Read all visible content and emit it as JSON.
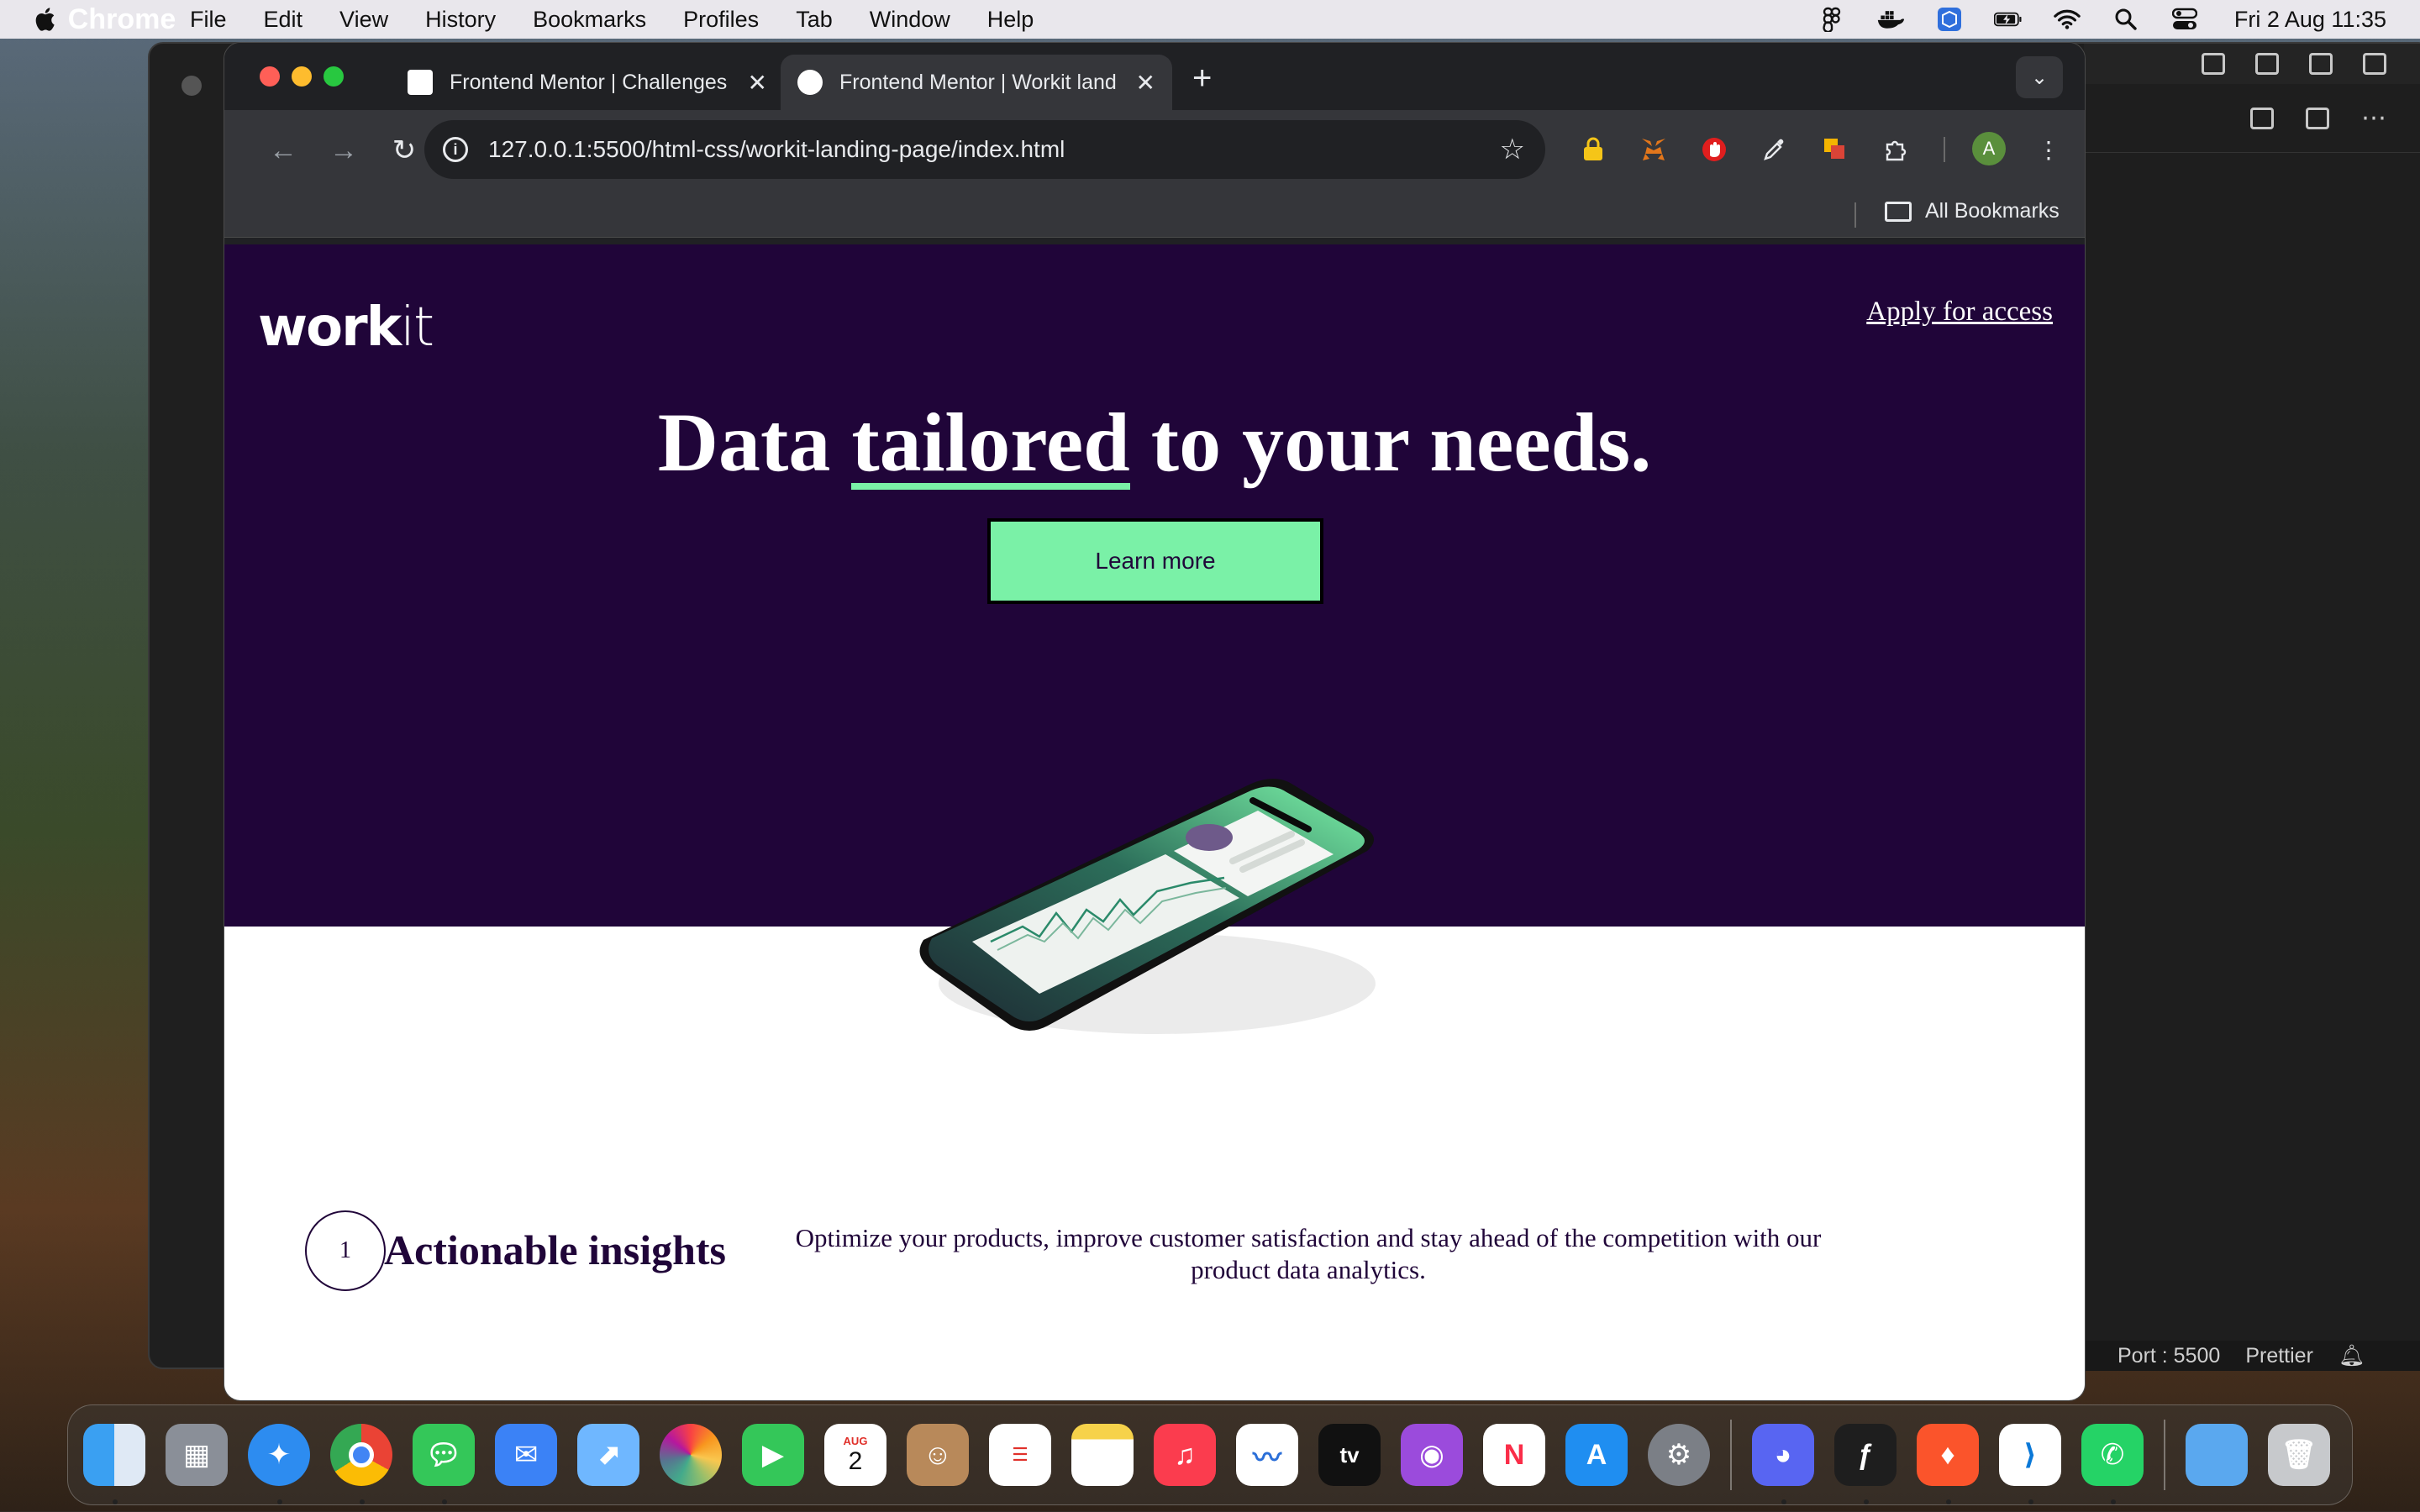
{
  "menubar": {
    "app_name": "Chrome",
    "items": [
      "File",
      "Edit",
      "View",
      "History",
      "Bookmarks",
      "Profiles",
      "Tab",
      "Window",
      "Help"
    ],
    "clock": "Fri 2 Aug  11:35",
    "status_icons": [
      "figma-icon",
      "docker-icon",
      "virtualbox-icon",
      "battery-charging-icon",
      "wifi-icon",
      "spotlight-search-icon",
      "control-center-icon"
    ]
  },
  "chrome": {
    "tabs": [
      {
        "title": "Frontend Mentor | Challenges",
        "active": false
      },
      {
        "title": "Frontend Mentor | Workit land",
        "active": true
      }
    ],
    "url": "127.0.0.1:5500/html-css/workit-landing-page/index.html",
    "bookmarks_label": "All Bookmarks",
    "profile_initial": "A",
    "extensions": [
      "lock-icon",
      "metamask-icon",
      "ublock-icon",
      "eyedropper-icon",
      "colorzilla-icon",
      "puzzle-icon"
    ]
  },
  "page": {
    "logo_bold": "work",
    "logo_light": "it",
    "apply_link": "Apply for access",
    "headline_pre": "Data ",
    "headline_underlined": "tailored",
    "headline_post": " to your needs.",
    "cta": "Learn more",
    "feature": {
      "number": "1",
      "title": "Actionable insights",
      "description": "Optimize your products, improve customer satisfaction and stay ahead of the competition with our product data analytics."
    }
  },
  "vscode_status": {
    "port": "Port : 5500",
    "prettier": "Prettier"
  },
  "colors": {
    "hero_bg": "#200539",
    "accent_green": "#7af1a7",
    "chrome_dark": "#202124",
    "chrome_toolbar": "#35363a"
  },
  "dock": {
    "apps": [
      "finder-icon",
      "launchpad-icon",
      "safari-icon",
      "chrome-icon",
      "messages-icon",
      "mail-icon",
      "maps-icon",
      "photos-icon",
      "facetime-icon",
      "calendar-icon",
      "contacts-icon",
      "reminders-icon",
      "notes-icon",
      "music-icon",
      "freeform-icon",
      "apple-tv-icon",
      "podcasts-icon",
      "news-icon",
      "app-store-icon",
      "system-settings-icon",
      "discord-icon",
      "figma-icon",
      "brave-icon",
      "vscode-icon",
      "whatsapp-icon",
      "downloads-folder-icon",
      "trash-icon"
    ],
    "calendar_month": "AUG",
    "calendar_day": "2",
    "tv_label": "tv"
  }
}
